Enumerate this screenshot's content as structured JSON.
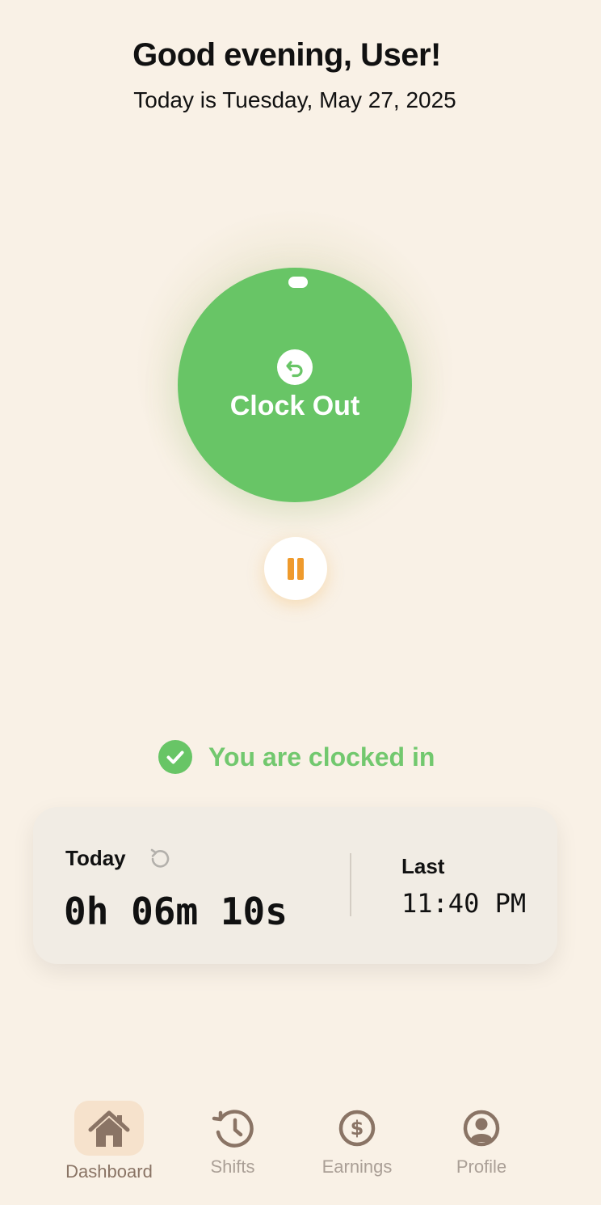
{
  "header": {
    "greeting": "Good evening, User!",
    "date_line": "Today is Tuesday, May 27, 2025"
  },
  "clock_button": {
    "label": "Clock Out",
    "icon": "undo-arrow-icon",
    "color": "#68c566"
  },
  "pause_button": {
    "icon": "pause-icon",
    "color": "#ef9a2c"
  },
  "status": {
    "text": "You are clocked in",
    "icon": "check-circle-icon",
    "color": "#72c86e"
  },
  "stats": {
    "today_label": "Today",
    "today_value": "0h 06m 10s",
    "reset_icon": "reset-icon",
    "last_label": "Last",
    "last_value": "11:40 PM"
  },
  "tabs": [
    {
      "label": "Dashboard",
      "icon": "home-icon",
      "active": true
    },
    {
      "label": "Shifts",
      "icon": "history-clock-icon",
      "active": false
    },
    {
      "label": "Earnings",
      "icon": "dollar-circle-icon",
      "active": false
    },
    {
      "label": "Profile",
      "icon": "user-circle-icon",
      "active": false
    }
  ],
  "colors": {
    "background": "#f9f1e6",
    "accent_green": "#68c566",
    "accent_orange": "#ef9a2c",
    "tab_active": "#8a7465",
    "tab_inactive": "#aa9f96"
  }
}
